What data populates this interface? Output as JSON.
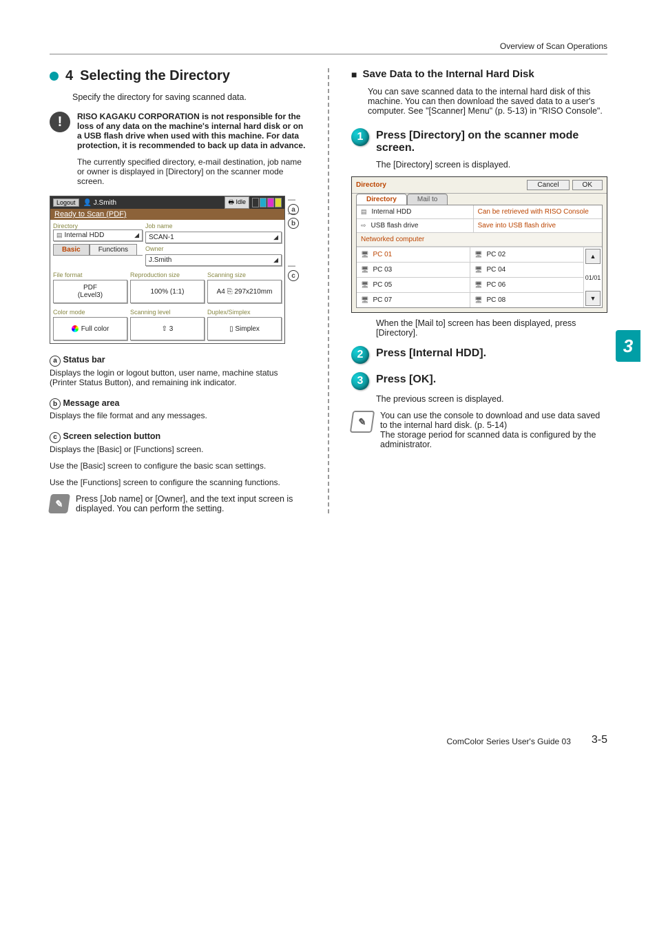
{
  "breadcrumb": "Overview of Scan Operations",
  "left": {
    "step_num": "4",
    "heading": "Selecting the Directory",
    "intro": "Specify the directory for saving scanned data.",
    "caution_bold": "RISO KAGAKU CORPORATION is not responsible for the loss of any data on the machine's internal hard disk or on a USB flash drive when used with this machine. For data protection, it is recommended to back up data in advance.",
    "caution_para": "The currently specified directory, e-mail destination, job name or owner is displayed in [Directory] on the scanner mode screen.",
    "panel": {
      "logout": "Logout",
      "user_icon": "👤",
      "user": "J.Smith",
      "status_icon": "🖶",
      "status": "Idle",
      "msg": "Ready to Scan (PDF)",
      "dir_label": "Directory",
      "dir_value": "Internal HDD",
      "job_label": "Job name",
      "job_value": "SCAN-1",
      "owner_label": "Owner",
      "owner_value": "J.Smith",
      "tab_basic": "Basic",
      "tab_functions": "Functions",
      "prop_format_label": "File format",
      "prop_format_value": "PDF\n(Level3)",
      "prop_repro_label": "Reproduction size",
      "prop_repro_value": "100% (1:1)",
      "prop_scan_label": "Scanning size",
      "prop_scan_value": "A4 ⎘ 297x210mm",
      "prop_color_label": "Color mode",
      "prop_color_value": "Full color",
      "prop_level_label": "Scanning level",
      "prop_level_value": "3",
      "prop_duplex_label": "Duplex/Simplex",
      "prop_duplex_value": "Simplex"
    },
    "annot1": "a",
    "annot2": "b",
    "annot3": "c",
    "def1_title": "Status bar",
    "def1_body": "Displays the login or logout button, user name, machine status (Printer Status Button), and remaining ink indicator.",
    "def2_title": "Message area",
    "def2_body": "Displays the file format and any messages.",
    "def3_title": "Screen selection button",
    "def3_body_a": "Displays the [Basic] or [Functions] screen.",
    "def3_body_b": "Use the [Basic] screen to configure the basic scan settings.",
    "def3_body_c": "Use the [Functions] screen to configure the scanning functions.",
    "note": "Press [Job name] or [Owner], and the text input screen is displayed. You can perform the setting."
  },
  "right": {
    "sub_heading": "Save Data to the Internal Hard Disk",
    "sub_body": "You can save scanned data to the internal hard disk of this machine. You can then download the saved data to a user's computer. See \"[Scanner] Menu\" (p. 5-13) in \"RISO Console\".",
    "step1_h": "Press [Directory] on the scanner mode screen.",
    "step1_b": "The [Directory] screen is displayed.",
    "dlg": {
      "title": "Directory",
      "cancel": "Cancel",
      "ok": "OK",
      "tab_dir": "Directory",
      "tab_mail": "Mail to",
      "row1_l": "Internal HDD",
      "row1_r": "Can be retrieved with RISO Console",
      "row2_l": "USB flash drive",
      "row2_r": "Save into USB flash drive",
      "section": "Networked computer",
      "pcs": [
        "PC 01",
        "PC 02",
        "PC 03",
        "PC 04",
        "PC 05",
        "PC 06",
        "PC 07",
        "PC 08"
      ],
      "page": "01/01",
      "up": "▲",
      "down": "▼"
    },
    "step1_after": "When the [Mail to] screen has been displayed, press [Directory].",
    "step2_h": "Press [Internal HDD].",
    "step3_h": "Press [OK].",
    "step3_b": "The previous screen is displayed.",
    "note": "You can use the console to download and use data saved to the internal hard disk. (p. 5-14)\nThe storage period for scanned data is configured by the administrator."
  },
  "chapter": "3",
  "footer_left": "ComColor Series User's Guide 03",
  "footer_right": "3-5"
}
